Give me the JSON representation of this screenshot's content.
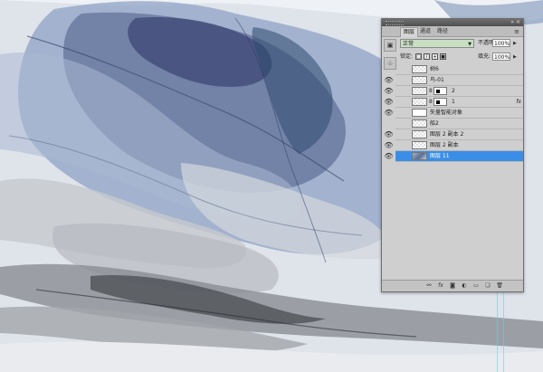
{
  "panel": {
    "tabs": [
      "图层",
      "通道",
      "路径"
    ],
    "blend_mode": "正常",
    "opacity_label": "不透明度:",
    "opacity_value": "100%",
    "lock_label": "锁定:",
    "fill_label": "填充:",
    "fill_value": "100%"
  },
  "layers": [
    {
      "name": "树6",
      "visible": false,
      "thumb": "transparent",
      "has_mask": false,
      "fx": false,
      "selected": false
    },
    {
      "name": "鸟-01",
      "visible": true,
      "thumb": "transparent",
      "has_mask": false,
      "fx": false,
      "selected": false
    },
    {
      "name": "2",
      "visible": true,
      "thumb": "transparent",
      "has_mask": true,
      "fx": false,
      "selected": false
    },
    {
      "name": "1",
      "visible": true,
      "thumb": "transparent",
      "has_mask": true,
      "fx": true,
      "selected": false
    },
    {
      "name": "矢量智能对象",
      "visible": true,
      "thumb": "smart",
      "has_mask": false,
      "fx": false,
      "selected": false
    },
    {
      "name": "船2",
      "visible": false,
      "thumb": "transparent",
      "has_mask": false,
      "fx": false,
      "selected": false
    },
    {
      "name": "图层 2 副本 2",
      "visible": true,
      "thumb": "transparent",
      "has_mask": false,
      "fx": false,
      "selected": false
    },
    {
      "name": "图层 2 副本",
      "visible": true,
      "thumb": "transparent",
      "has_mask": false,
      "fx": false,
      "selected": false
    },
    {
      "name": "图层 11",
      "visible": true,
      "thumb": "art",
      "has_mask": false,
      "fx": false,
      "selected": true
    }
  ],
  "fx_label": "fx",
  "icons": {
    "eye": "eye-icon",
    "chain": "link-icon",
    "footer": [
      "link-layers-icon",
      "add-style-icon",
      "add-mask-icon",
      "adjustment-icon",
      "new-group-icon",
      "new-layer-icon",
      "delete-icon"
    ]
  },
  "colors": {
    "selection": "#3b8ee8",
    "blend_field": "#c8dfc2",
    "panel_bg": "#cfcfcf"
  }
}
